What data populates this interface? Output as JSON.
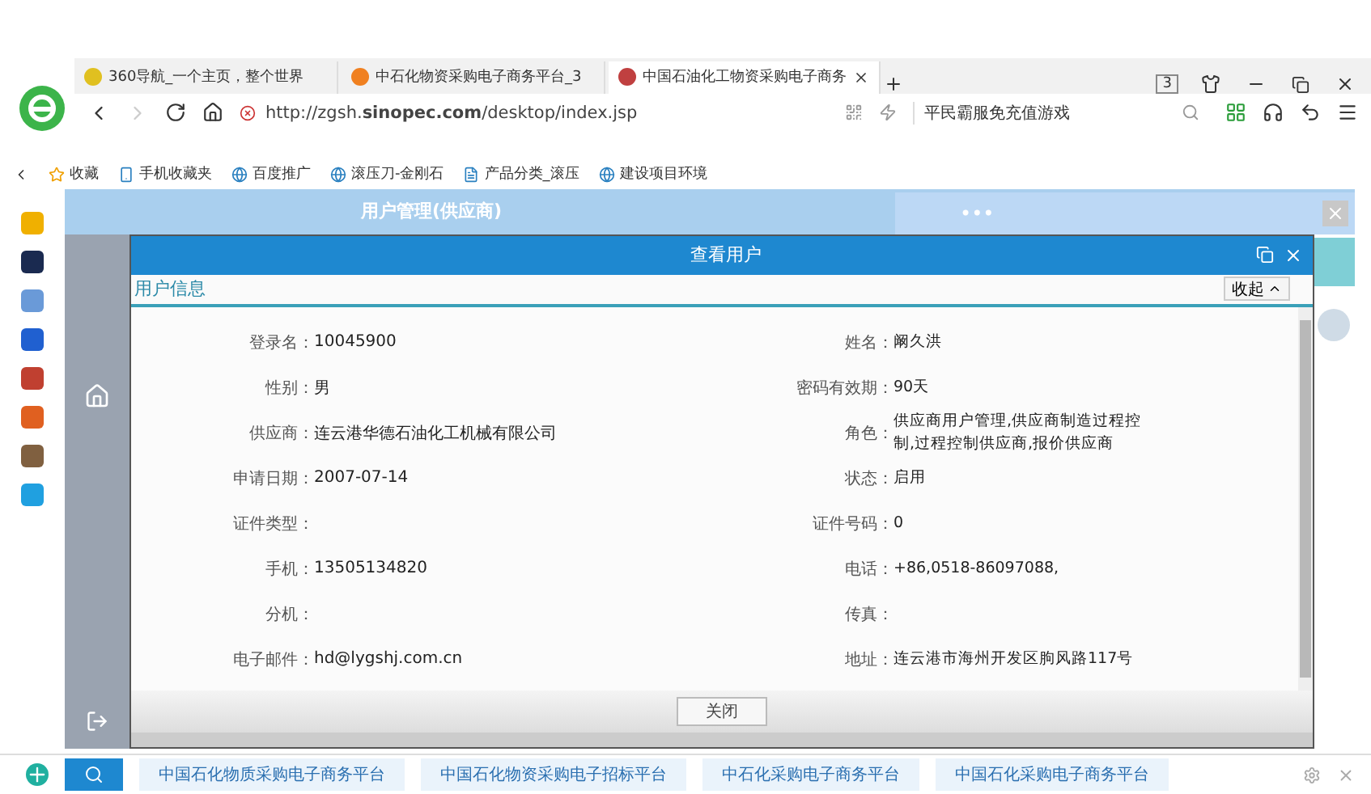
{
  "browser_tabs": [
    {
      "title": "360导航_一个主页，整个世界",
      "selected": false
    },
    {
      "title": "中石化物资采购电子商务平台_3",
      "selected": false
    },
    {
      "title": "中国石油化工物资采购电子商务",
      "selected": true
    }
  ],
  "tab_count": "3",
  "address": "http://zgsh.**sinopec.com**/desktop/index.jsp",
  "search": {
    "value": "平民霸服免充值游戏"
  },
  "bookmarks": [
    "收藏",
    "手机收藏夹",
    "百度推广",
    "滚压刀-金刚石",
    "产品分类_滚压",
    "建设项目环境"
  ],
  "page_title": "用户管理(供应商)",
  "popup": {
    "dots": "•••"
  },
  "dialog": {
    "title": "查看用户",
    "section": "用户信息",
    "collapse": "收起",
    "rows": [
      {
        "label": "登录名：",
        "value": "10045900",
        "label2": "姓名：",
        "value2": "阚久洪"
      },
      {
        "label": "性别：",
        "value": "男",
        "label2": "密码有效期：",
        "value2": "90天"
      },
      {
        "label": "供应商：",
        "value": "连云港华德石油化工机械有限公司",
        "label2": "角色：",
        "value2": "供应商用户管理,供应商制造过程控制,过程控制供应商,报价供应商"
      },
      {
        "label": "申请日期：",
        "value": "2007-07-14",
        "label2": "状态：",
        "value2": "启用"
      },
      {
        "label": "证件类型：",
        "value": "",
        "label2": "证件号码：",
        "value2": "0"
      },
      {
        "label": "手机：",
        "value": "13505134820",
        "label2": "电话：",
        "value2": "+86,0518-86097088,"
      },
      {
        "label": "分机：",
        "value": "",
        "label2": "传真：",
        "value2": ""
      },
      {
        "label": "电子邮件：",
        "value": "hd@lygshj.com.cn",
        "label2": "地址：",
        "value2": "连云港市海州开发区朐风路117号"
      }
    ],
    "close_button": "关闭"
  },
  "bottom_links": [
    "中国石化物质采购电子商务平台",
    "中国石化物资采购电子招标平台",
    "中石化采购电子商务平台",
    "中国石化采购电子商务平台"
  ]
}
